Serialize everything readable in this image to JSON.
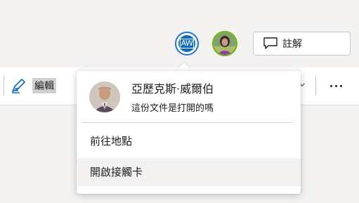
{
  "header": {
    "presence": {
      "self_initials": "AW",
      "colors": {
        "self_ring": "#1a73e8",
        "self_fill": "#0f6cbd",
        "other_ring": "#6bb700"
      }
    },
    "comments_label": "註解"
  },
  "ribbon": {
    "edit_label": "編輯",
    "icons": {
      "edit": "pen-icon",
      "more": "more-icon",
      "chevron": "chevron-down-icon"
    }
  },
  "contact_card": {
    "name": "亞歷克斯·威爾伯",
    "subtitle": "這份文件是打開的嗎",
    "menu": [
      {
        "label": "前往地點"
      },
      {
        "label": "開啟接觸卡"
      }
    ]
  }
}
